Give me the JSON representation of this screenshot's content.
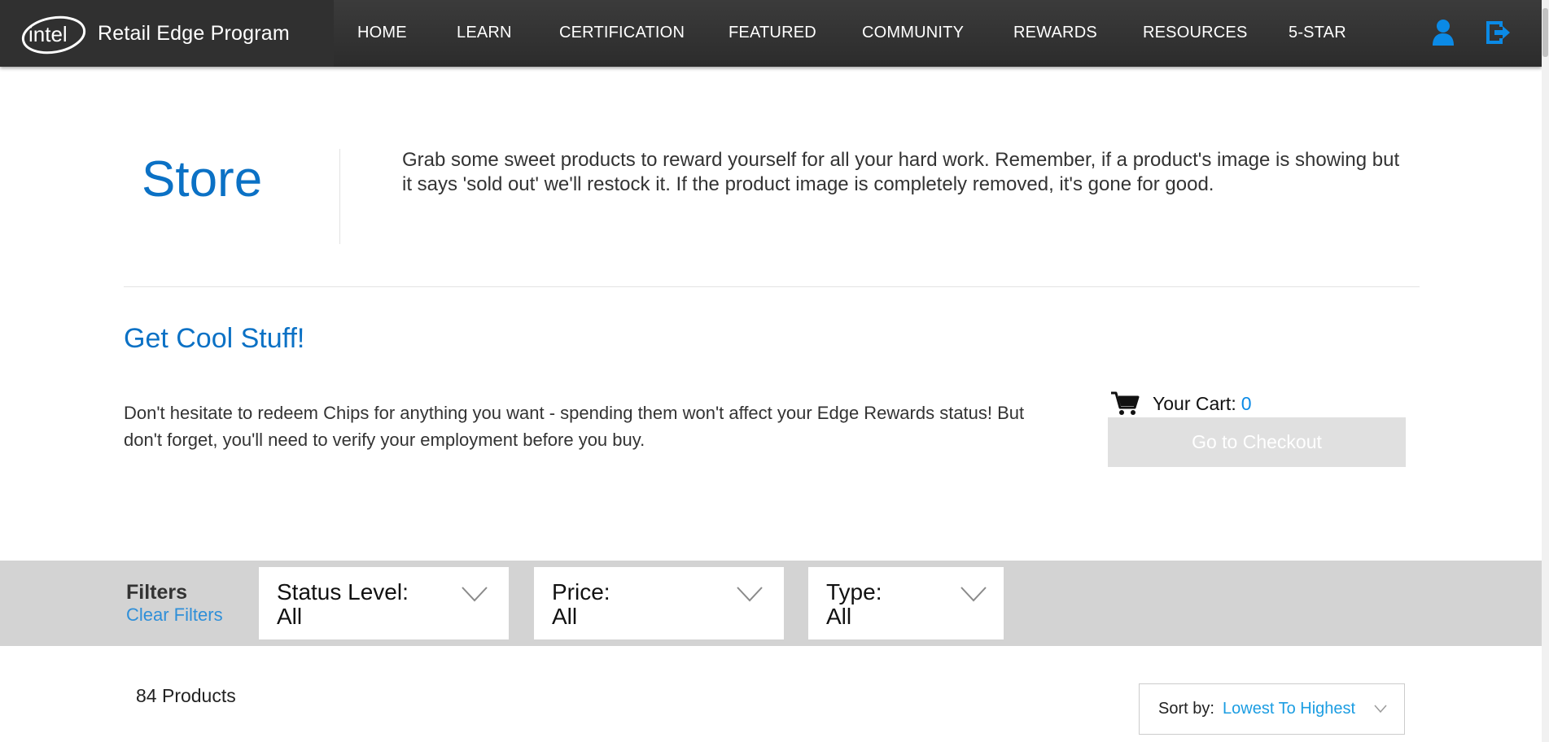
{
  "header": {
    "logo_text": "intel",
    "brand_name": "Retail Edge Program",
    "nav": [
      {
        "label": "HOME"
      },
      {
        "label": "LEARN"
      },
      {
        "label": "CERTIFICATION"
      },
      {
        "label": "FEATURED"
      },
      {
        "label": "COMMUNITY"
      },
      {
        "label": "REWARDS"
      },
      {
        "label": "RESOURCES"
      },
      {
        "label": "5-STAR"
      }
    ],
    "icons": {
      "profile": "user-icon",
      "logout": "sign-out-icon"
    },
    "icon_color": "#0b8ae6"
  },
  "store": {
    "title": "Store",
    "description": "Grab some sweet products to reward yourself for all your hard work. Remember, if a product's image is showing but it says 'sold out' we'll restock it. If the product image is completely removed, it's gone for good."
  },
  "promo": {
    "title": "Get Cool Stuff!",
    "description": "Don't hesitate to redeem Chips for anything you want - spending them won't affect your Edge Rewards status! But don't forget, you'll need to verify your employment before you buy."
  },
  "cart": {
    "icon": "shopping-cart-icon",
    "label": "Your Cart:",
    "count": "0",
    "checkout_label": "Go to Checkout",
    "checkout_enabled": false
  },
  "filters": {
    "heading": "Filters",
    "clear_label": "Clear Filters",
    "items": [
      {
        "label": "Status Level:",
        "value": "All"
      },
      {
        "label": "Price:",
        "value": "All"
      },
      {
        "label": "Type:",
        "value": "All"
      }
    ]
  },
  "results": {
    "count_text": "84 Products",
    "sort_label": "Sort by:",
    "sort_value": "Lowest To Highest"
  },
  "colors": {
    "accent": "#0b71c5",
    "link": "#2f8fd8",
    "header_bg": "#333333",
    "filter_bar_bg": "#d3d3d3",
    "disabled_button_bg": "#e0e0e0"
  }
}
